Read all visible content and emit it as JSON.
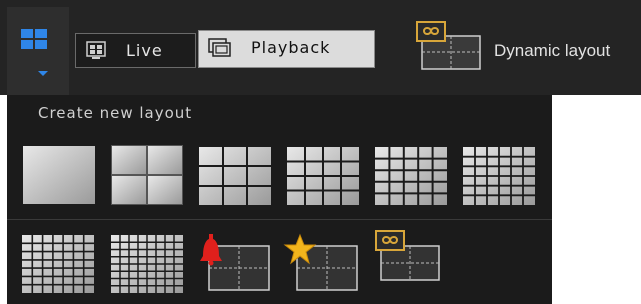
{
  "toolbar": {
    "layout_menu_icon": "grid-icon",
    "live_label": "Live",
    "playback_label": "Playback",
    "dynamic_layout_label": "Dynamic layout",
    "colors": {
      "accent": "#2f86e8",
      "toolbar_bg": "#242424",
      "active_tab_bg": "#dcdcdc"
    }
  },
  "dropdown": {
    "title": "Create new layout",
    "grid_layouts": [
      "1x1",
      "2x2",
      "3x3",
      "4x4",
      "5x5",
      "6x6",
      "7x7",
      "8x8"
    ],
    "special_layouts": [
      "alarm-layout-icon",
      "favorite-layout-icon",
      "dynamic-layout-icon"
    ]
  }
}
